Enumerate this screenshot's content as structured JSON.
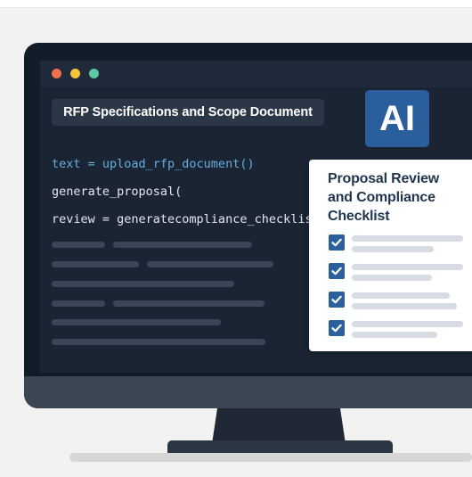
{
  "window": {
    "controls": [
      {
        "name": "close",
        "color": "#f0714a"
      },
      {
        "name": "minimize",
        "color": "#f2c53a"
      },
      {
        "name": "maximize",
        "color": "#5cc9a3"
      }
    ]
  },
  "document": {
    "title": "RFP Specifications and Scope Document"
  },
  "ai_badge": {
    "label": "AI"
  },
  "code": {
    "lines": [
      "text = upload_rfp_document()",
      "generate_proposal(",
      "review = generatecompliance_checklist"
    ]
  },
  "checklist": {
    "title": "Proposal Review and Compliance Checklist",
    "items": [
      {
        "checked": true
      },
      {
        "checked": true
      },
      {
        "checked": true
      },
      {
        "checked": true
      }
    ]
  },
  "colors": {
    "accent": "#2b5e9c",
    "screen_bg": "#1a2433",
    "code_keyword": "#67aee0"
  }
}
